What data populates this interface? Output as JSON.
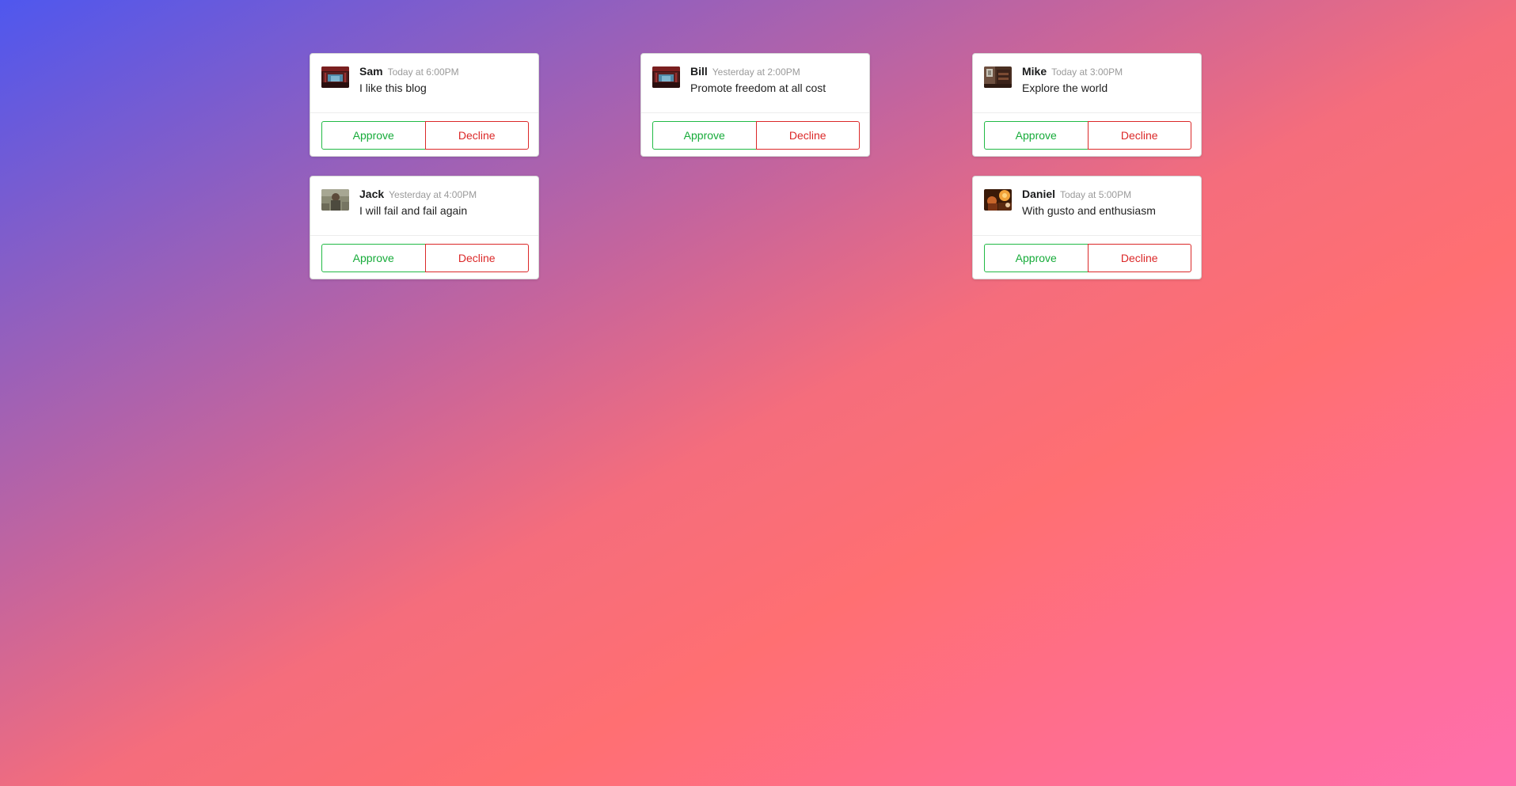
{
  "cards": [
    {
      "author": "Sam",
      "date": "Today at 6:00PM",
      "text": "I like this blog",
      "approve_label": "Approve",
      "decline_label": "Decline"
    },
    {
      "author": "Bill",
      "date": "Yesterday at 2:00PM",
      "text": "Promote freedom at all cost",
      "approve_label": "Approve",
      "decline_label": "Decline"
    },
    {
      "author": "Mike",
      "date": "Today at 3:00PM",
      "text": "Explore the world",
      "approve_label": "Approve",
      "decline_label": "Decline"
    },
    {
      "author": "Jack",
      "date": "Yesterday at 4:00PM",
      "text": "I will fail and fail again",
      "approve_label": "Approve",
      "decline_label": "Decline"
    },
    {
      "author": "Daniel",
      "date": "Today at 5:00PM",
      "text": "With gusto and enthusiasm",
      "approve_label": "Approve",
      "decline_label": "Decline"
    }
  ],
  "colors": {
    "approve": "#21ba45",
    "decline": "#db2828",
    "gradient_start": "#4f57ee",
    "gradient_mid": "#ff6f72",
    "gradient_end": "#ff6fad"
  }
}
